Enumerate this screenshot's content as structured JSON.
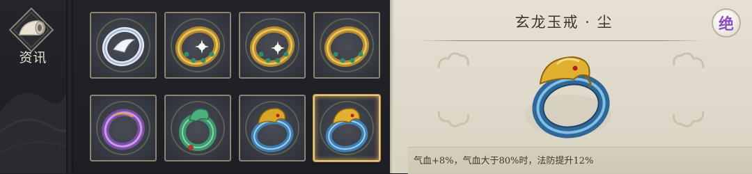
{
  "nav": {
    "label": "资讯",
    "icon": "scroll-horn-icon"
  },
  "grid": {
    "items": [
      {
        "name": "silver-ring",
        "selected": false
      },
      {
        "name": "gold-jeweled-ring-1",
        "selected": false
      },
      {
        "name": "gold-jeweled-ring-2",
        "selected": false
      },
      {
        "name": "gold-jeweled-ring-3",
        "selected": false
      },
      {
        "name": "purple-jade-ring",
        "selected": false
      },
      {
        "name": "green-jade-dragon-ring",
        "selected": false
      },
      {
        "name": "gold-dragon-blue-ring-1",
        "selected": false
      },
      {
        "name": "gold-dragon-blue-ring-2",
        "selected": true
      }
    ]
  },
  "detail": {
    "title": "玄龙玉戒 · 尘",
    "badge": "绝",
    "description": "气血+8%，气血大于80%时，法防提升12%"
  },
  "colors": {
    "slot_border": "#8d8570",
    "selected_border": "#f0c77a",
    "panel_bg": "#e2ddcf",
    "gold": "#d9a728",
    "jade_blue": "#3f7fb2"
  }
}
